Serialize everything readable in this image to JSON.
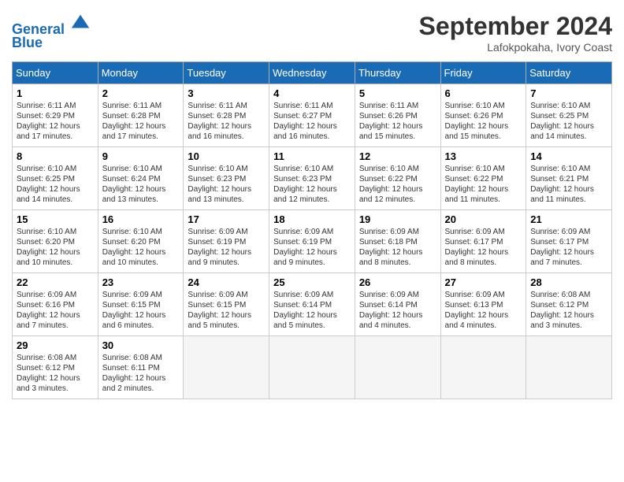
{
  "header": {
    "logo_line1": "General",
    "logo_line2": "Blue",
    "month_title": "September 2024",
    "location": "Lafokpokaha, Ivory Coast"
  },
  "weekdays": [
    "Sunday",
    "Monday",
    "Tuesday",
    "Wednesday",
    "Thursday",
    "Friday",
    "Saturday"
  ],
  "weeks": [
    [
      {
        "day": "1",
        "info": "Sunrise: 6:11 AM\nSunset: 6:29 PM\nDaylight: 12 hours\nand 17 minutes."
      },
      {
        "day": "2",
        "info": "Sunrise: 6:11 AM\nSunset: 6:28 PM\nDaylight: 12 hours\nand 17 minutes."
      },
      {
        "day": "3",
        "info": "Sunrise: 6:11 AM\nSunset: 6:28 PM\nDaylight: 12 hours\nand 16 minutes."
      },
      {
        "day": "4",
        "info": "Sunrise: 6:11 AM\nSunset: 6:27 PM\nDaylight: 12 hours\nand 16 minutes."
      },
      {
        "day": "5",
        "info": "Sunrise: 6:11 AM\nSunset: 6:26 PM\nDaylight: 12 hours\nand 15 minutes."
      },
      {
        "day": "6",
        "info": "Sunrise: 6:10 AM\nSunset: 6:26 PM\nDaylight: 12 hours\nand 15 minutes."
      },
      {
        "day": "7",
        "info": "Sunrise: 6:10 AM\nSunset: 6:25 PM\nDaylight: 12 hours\nand 14 minutes."
      }
    ],
    [
      {
        "day": "8",
        "info": "Sunrise: 6:10 AM\nSunset: 6:25 PM\nDaylight: 12 hours\nand 14 minutes."
      },
      {
        "day": "9",
        "info": "Sunrise: 6:10 AM\nSunset: 6:24 PM\nDaylight: 12 hours\nand 13 minutes."
      },
      {
        "day": "10",
        "info": "Sunrise: 6:10 AM\nSunset: 6:23 PM\nDaylight: 12 hours\nand 13 minutes."
      },
      {
        "day": "11",
        "info": "Sunrise: 6:10 AM\nSunset: 6:23 PM\nDaylight: 12 hours\nand 12 minutes."
      },
      {
        "day": "12",
        "info": "Sunrise: 6:10 AM\nSunset: 6:22 PM\nDaylight: 12 hours\nand 12 minutes."
      },
      {
        "day": "13",
        "info": "Sunrise: 6:10 AM\nSunset: 6:22 PM\nDaylight: 12 hours\nand 11 minutes."
      },
      {
        "day": "14",
        "info": "Sunrise: 6:10 AM\nSunset: 6:21 PM\nDaylight: 12 hours\nand 11 minutes."
      }
    ],
    [
      {
        "day": "15",
        "info": "Sunrise: 6:10 AM\nSunset: 6:20 PM\nDaylight: 12 hours\nand 10 minutes."
      },
      {
        "day": "16",
        "info": "Sunrise: 6:10 AM\nSunset: 6:20 PM\nDaylight: 12 hours\nand 10 minutes."
      },
      {
        "day": "17",
        "info": "Sunrise: 6:09 AM\nSunset: 6:19 PM\nDaylight: 12 hours\nand 9 minutes."
      },
      {
        "day": "18",
        "info": "Sunrise: 6:09 AM\nSunset: 6:19 PM\nDaylight: 12 hours\nand 9 minutes."
      },
      {
        "day": "19",
        "info": "Sunrise: 6:09 AM\nSunset: 6:18 PM\nDaylight: 12 hours\nand 8 minutes."
      },
      {
        "day": "20",
        "info": "Sunrise: 6:09 AM\nSunset: 6:17 PM\nDaylight: 12 hours\nand 8 minutes."
      },
      {
        "day": "21",
        "info": "Sunrise: 6:09 AM\nSunset: 6:17 PM\nDaylight: 12 hours\nand 7 minutes."
      }
    ],
    [
      {
        "day": "22",
        "info": "Sunrise: 6:09 AM\nSunset: 6:16 PM\nDaylight: 12 hours\nand 7 minutes."
      },
      {
        "day": "23",
        "info": "Sunrise: 6:09 AM\nSunset: 6:15 PM\nDaylight: 12 hours\nand 6 minutes."
      },
      {
        "day": "24",
        "info": "Sunrise: 6:09 AM\nSunset: 6:15 PM\nDaylight: 12 hours\nand 5 minutes."
      },
      {
        "day": "25",
        "info": "Sunrise: 6:09 AM\nSunset: 6:14 PM\nDaylight: 12 hours\nand 5 minutes."
      },
      {
        "day": "26",
        "info": "Sunrise: 6:09 AM\nSunset: 6:14 PM\nDaylight: 12 hours\nand 4 minutes."
      },
      {
        "day": "27",
        "info": "Sunrise: 6:09 AM\nSunset: 6:13 PM\nDaylight: 12 hours\nand 4 minutes."
      },
      {
        "day": "28",
        "info": "Sunrise: 6:08 AM\nSunset: 6:12 PM\nDaylight: 12 hours\nand 3 minutes."
      }
    ],
    [
      {
        "day": "29",
        "info": "Sunrise: 6:08 AM\nSunset: 6:12 PM\nDaylight: 12 hours\nand 3 minutes."
      },
      {
        "day": "30",
        "info": "Sunrise: 6:08 AM\nSunset: 6:11 PM\nDaylight: 12 hours\nand 2 minutes."
      },
      {
        "day": "",
        "info": ""
      },
      {
        "day": "",
        "info": ""
      },
      {
        "day": "",
        "info": ""
      },
      {
        "day": "",
        "info": ""
      },
      {
        "day": "",
        "info": ""
      }
    ]
  ]
}
